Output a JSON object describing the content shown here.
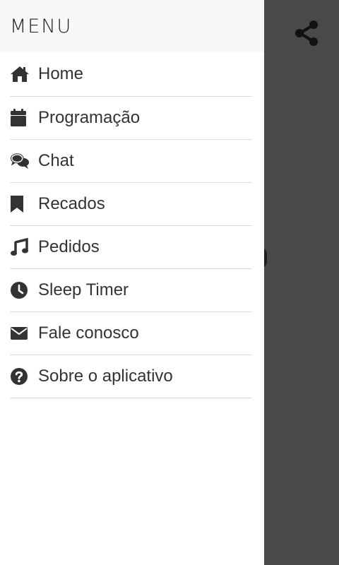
{
  "drawer": {
    "title": "MENU",
    "items": [
      {
        "label": "Home",
        "icon": "home-icon"
      },
      {
        "label": "Programação",
        "icon": "calendar-icon"
      },
      {
        "label": "Chat",
        "icon": "chat-icon"
      },
      {
        "label": "Recados",
        "icon": "bookmark-icon"
      },
      {
        "label": "Pedidos",
        "icon": "music-icon"
      },
      {
        "label": "Sleep Timer",
        "icon": "clock-icon"
      },
      {
        "label": "Fale conosco",
        "icon": "envelope-icon"
      },
      {
        "label": "Sobre o aplicativo",
        "icon": "question-icon"
      }
    ]
  },
  "toolbar": {
    "share_icon": "share-icon"
  },
  "colors": {
    "drawer_background": "#ffffff",
    "header_background": "#f8f8f8",
    "backdrop": "#494949",
    "text": "#333333",
    "divider": "#dcdcdc"
  }
}
